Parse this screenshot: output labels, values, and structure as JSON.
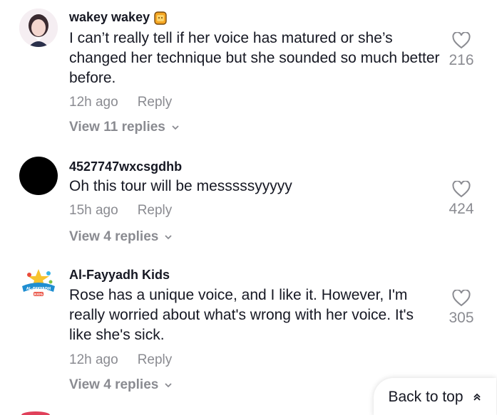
{
  "comments": [
    {
      "username": "wakey wakey",
      "badge_icon": "bread-emoji-icon",
      "text": "I can’t really tell if her voice has matured or she’s changed her technique but she sounded so much better before.",
      "time": "12h ago",
      "reply_label": "Reply",
      "view_replies": "View 11 replies",
      "likes": "216"
    },
    {
      "username": "4527747wxcsgdhb",
      "text": "Oh this tour will be messsssyyyyy",
      "time": "15h ago",
      "reply_label": "Reply",
      "view_replies": "View 4 replies",
      "likes": "424"
    },
    {
      "username": "Al-Fayyadh Kids",
      "text": "Rose has a unique voice, and I like it. However, I'm really worried about what's wrong with her voice. It's like she's sick.",
      "time": "12h ago",
      "reply_label": "Reply",
      "view_replies": "View 4 replies",
      "likes": "305",
      "avatar_logo_text": "AL-FAYYADH KIDS"
    }
  ],
  "back_to_top": {
    "label": "Back to top",
    "icon": "double-chevron-up-icon"
  },
  "colors": {
    "text": "#161823",
    "muted": "#8a8b91",
    "background": "#ffffff"
  }
}
